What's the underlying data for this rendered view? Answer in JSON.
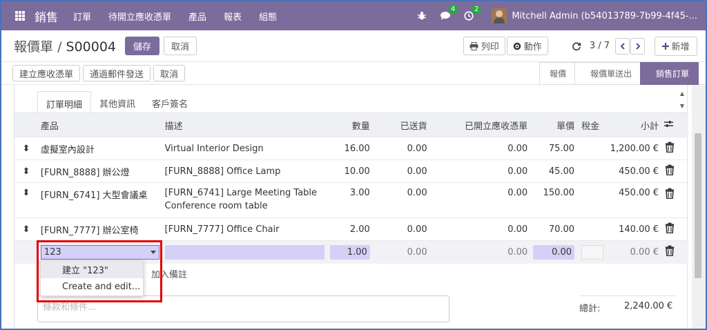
{
  "navbar": {
    "brand": "銷售",
    "menu": [
      "訂單",
      "待開立應收憑單",
      "產品",
      "報表",
      "組態"
    ],
    "chat_count": "4",
    "activity_count": "2",
    "user": "Mitchell Admin (b54013789-7b99-4f45-..."
  },
  "control_panel": {
    "breadcrumb_parent": "報價單",
    "breadcrumb_sep": "/",
    "record": "S00004",
    "save": "儲存",
    "discard": "取消",
    "print": "列印",
    "action": "動作",
    "pager": "3 / 7",
    "new": "新增"
  },
  "statusbar": {
    "buttons": [
      "建立應收憑單",
      "通過郵件發送",
      "取消"
    ],
    "stages": [
      "報價",
      "報價單送出",
      "銷售訂單"
    ],
    "active_stage": "銷售訂單"
  },
  "tabs": [
    "訂單明細",
    "其他資訊",
    "客戶簽名"
  ],
  "table": {
    "headers": {
      "product": "產品",
      "description": "描述",
      "qty": "數量",
      "delivered": "已送貨",
      "invoiced": "已開立應收憑單",
      "price": "單價",
      "taxes": "稅金",
      "subtotal": "小計"
    },
    "rows": [
      {
        "product": "虛擬室內設計",
        "description": "Virtual Interior Design",
        "description2": "",
        "qty": "16.00",
        "delivered": "0.00",
        "invoiced": "0.00",
        "price": "75.00",
        "subtotal": "1,200.00 €"
      },
      {
        "product": "[FURN_8888] 辦公燈",
        "description": "[FURN_8888] Office Lamp",
        "description2": "",
        "qty": "10.00",
        "delivered": "0.00",
        "invoiced": "0.00",
        "price": "45.00",
        "subtotal": "450.00 €"
      },
      {
        "product": "[FURN_6741] 大型會議桌",
        "description": "[FURN_6741] Large Meeting Table",
        "description2": "Conference room table",
        "qty": "3.00",
        "delivered": "0.00",
        "invoiced": "0.00",
        "price": "150.00",
        "subtotal": "450.00 €"
      },
      {
        "product": "[FURN_7777] 辦公室椅",
        "description": "[FURN_7777] Office Chair",
        "description2": "",
        "qty": "2.00",
        "delivered": "0.00",
        "invoiced": "0.00",
        "price": "70.00",
        "subtotal": "140.00 €"
      }
    ],
    "edit_row": {
      "product_value": "123",
      "qty": "1.00",
      "delivered": "0.00",
      "invoiced": "0.00",
      "price": "0.00",
      "subtotal": "0.00 €"
    }
  },
  "dropdown": {
    "items": [
      "建立 \"123\"",
      "Create and edit..."
    ]
  },
  "add_note": "加入備註",
  "terms_placeholder": "條款和條件...",
  "total": {
    "label": "總計:",
    "value": "2,240.00 €"
  },
  "colors": {
    "brand": "#7c6c9c",
    "badge": "#28a745",
    "edit_highlight": "#d5d0f7",
    "annotation": "#e00000"
  }
}
